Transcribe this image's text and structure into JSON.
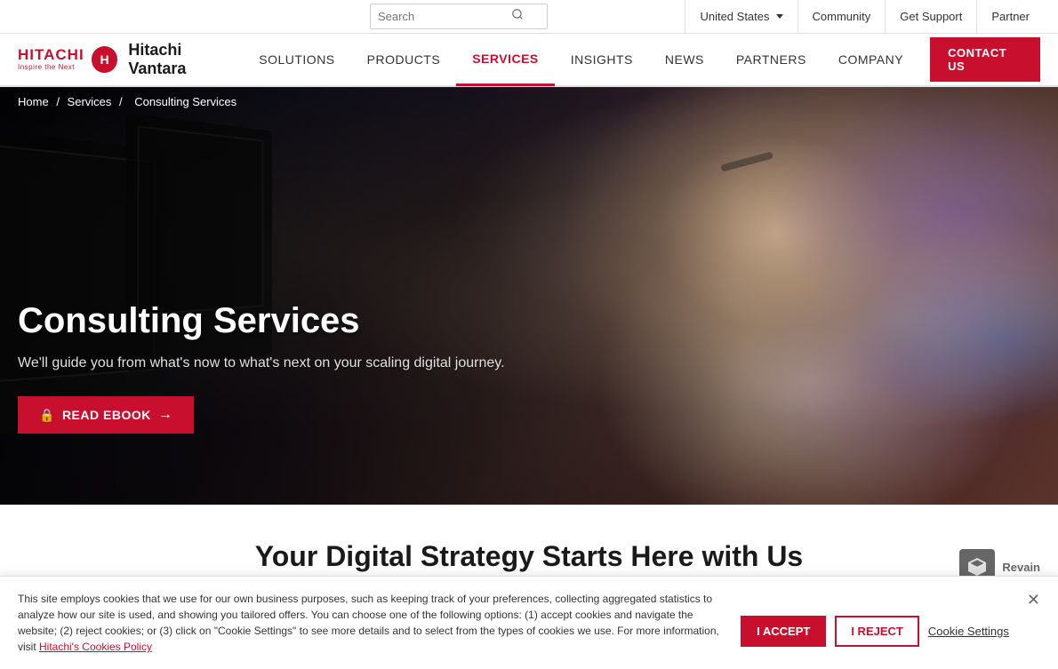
{
  "topbar": {
    "search_placeholder": "Search",
    "region_label": "United States",
    "links": [
      {
        "label": "Community"
      },
      {
        "label": "Get Support"
      },
      {
        "label": "Partner"
      }
    ]
  },
  "brand": {
    "hitachi_line1": "HITACHI",
    "hitachi_line2": "Inspire the Next",
    "name": "Hitachi Vantara"
  },
  "nav": {
    "links": [
      {
        "label": "SOLUTIONS",
        "active": false
      },
      {
        "label": "PRODUCTS",
        "active": false
      },
      {
        "label": "SERVICES",
        "active": true
      },
      {
        "label": "INSIGHTS",
        "active": false
      },
      {
        "label": "NEWS",
        "active": false
      },
      {
        "label": "PARTNERS",
        "active": false
      },
      {
        "label": "COMPANY",
        "active": false
      }
    ],
    "contact_label": "CONTACT US"
  },
  "breadcrumb": {
    "home": "Home",
    "services": "Services",
    "current": "Consulting Services"
  },
  "hero": {
    "title": "Consulting Services",
    "subtitle": "We'll guide you from what's now to what's next on your scaling digital journey.",
    "ebook_label": "READ EBOOK"
  },
  "section": {
    "title": "Your Digital Strategy Starts Here with Us"
  },
  "cookie": {
    "text": "This site employs cookies that we use for our own business purposes, such as keeping track of your preferences, collecting aggregated statistics to analyze how our site is used, and showing you tailored offers. You can choose one of the following options: (1) accept cookies and navigate the website; (2) reject cookies; or (3) click on \"Cookie Settings\" to see more details and to select from the types of cookies we use. For more information, visit ",
    "link_text": "Hitachi's Cookies Policy",
    "accept_label": "I ACCEPT",
    "reject_label": "I REJECT",
    "settings_label": "Cookie Settings"
  },
  "revain": {
    "label": "Revain"
  }
}
